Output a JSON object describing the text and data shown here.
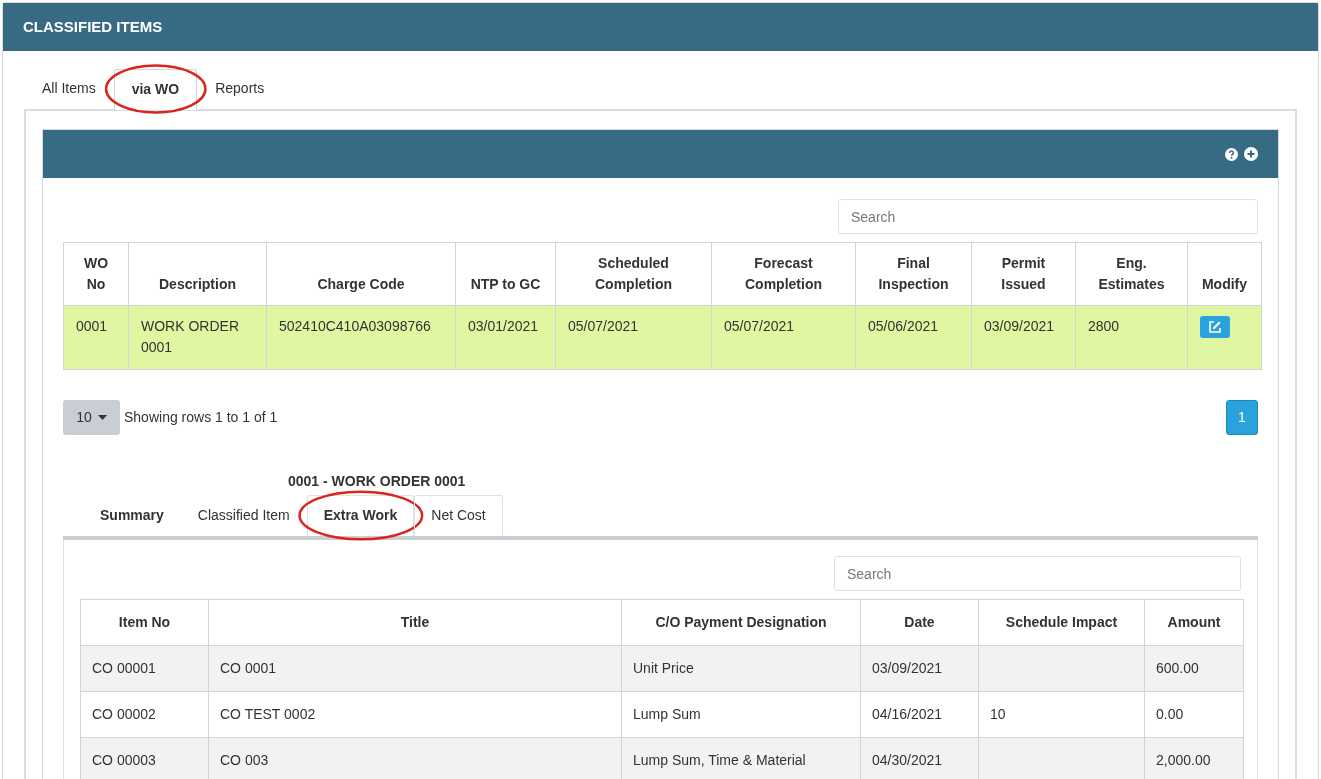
{
  "panel": {
    "title": "CLASSIFIED ITEMS"
  },
  "tabs": [
    {
      "label": "All Items",
      "selected": false,
      "highlighted": false
    },
    {
      "label": "via WO",
      "selected": true,
      "highlighted": true
    },
    {
      "label": "Reports",
      "selected": false,
      "highlighted": false
    }
  ],
  "work_orders": {
    "search": {
      "placeholder": "Search"
    },
    "columns": [
      "WO No",
      "Description",
      "Charge Code",
      "NTP to GC",
      "Scheduled Completion",
      "Forecast Completion",
      "Final Inspection",
      "Permit Issued",
      "Eng. Estimates",
      "Modify"
    ],
    "rows": [
      {
        "selected": true,
        "cells": [
          "0001",
          "WORK ORDER 0001",
          "502410C410A03098766",
          "03/01/2021",
          "05/07/2021",
          "05/07/2021",
          "05/06/2021",
          "03/09/2021",
          "2800"
        ]
      }
    ],
    "page_size": "10",
    "info": "Showing rows 1 to 1 of 1",
    "pages": [
      {
        "label": "1",
        "selected": true
      }
    ]
  },
  "detail": {
    "title": "0001 - WORK ORDER 0001",
    "tabs": [
      {
        "label": "Summary",
        "selected": false,
        "bold": true,
        "outlined": false,
        "highlighted": false
      },
      {
        "label": "Classified Item",
        "selected": false,
        "bold": false,
        "outlined": false,
        "highlighted": false
      },
      {
        "label": "Extra Work",
        "selected": true,
        "bold": true,
        "outlined": true,
        "highlighted": true
      },
      {
        "label": "Net Cost",
        "selected": false,
        "bold": false,
        "outlined": true,
        "highlighted": false
      }
    ],
    "search": {
      "placeholder": "Search"
    },
    "columns": [
      "Item No",
      "Title",
      "C/O Payment Designation",
      "Date",
      "Schedule Impact",
      "Amount"
    ],
    "rows": [
      [
        "CO 00001",
        "CO 0001",
        "Unit Price",
        "03/09/2021",
        "",
        "600.00"
      ],
      [
        "CO 00002",
        "CO TEST 0002",
        "Lump Sum",
        "04/16/2021",
        "10",
        "0.00"
      ],
      [
        "CO 00003",
        "CO 003",
        "Lump Sum, Time & Material",
        "04/30/2021",
        "",
        "2,000.00"
      ]
    ]
  }
}
